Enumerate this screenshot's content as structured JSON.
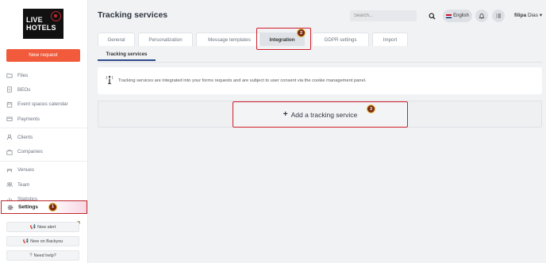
{
  "sidebar": {
    "logo": {
      "line1": "LIVE",
      "line2": "HOTELS"
    },
    "new_request_label": "New request",
    "items": [
      {
        "label": "Files",
        "icon": "folder-icon"
      },
      {
        "label": "BEOs",
        "icon": "document-icon"
      },
      {
        "label": "Event spaces calendar",
        "icon": "calendar-icon"
      },
      {
        "label": "Payments",
        "icon": "payment-icon"
      },
      {
        "label": "Clients",
        "icon": "clients-icon"
      },
      {
        "label": "Companies",
        "icon": "companies-icon"
      },
      {
        "label": "Venues",
        "icon": "venues-icon"
      },
      {
        "label": "Team",
        "icon": "team-icon"
      },
      {
        "label": "Statistics",
        "icon": "statistics-icon"
      }
    ],
    "settings": {
      "label": "Settings",
      "step": "1"
    },
    "buttons": {
      "new_alert": "New alert",
      "new_on_backyou": "New on Backyou",
      "need_help": "Need help?"
    }
  },
  "header": {
    "title": "Tracking services",
    "search_placeholder": "Search...",
    "language": "English",
    "user_first": "filipa",
    "user_last": "Dias"
  },
  "tabs": [
    {
      "label": "General"
    },
    {
      "label": "Personalization"
    },
    {
      "label": "Message templates"
    },
    {
      "label": "Integration"
    },
    {
      "label": "GDPR settings"
    },
    {
      "label": "Import"
    }
  ],
  "tab_step": "2",
  "subtab_label": "Tracking services",
  "info_text": "Tracking services are integrated into your forms requests and are subject to user consent via the cookie management panel.",
  "add_service": {
    "label": "Add a tracking service",
    "step": "3"
  },
  "colors": {
    "accent": "#f15a3a",
    "highlight": "#d11e2a",
    "active_tab": "#dfe2e6"
  }
}
